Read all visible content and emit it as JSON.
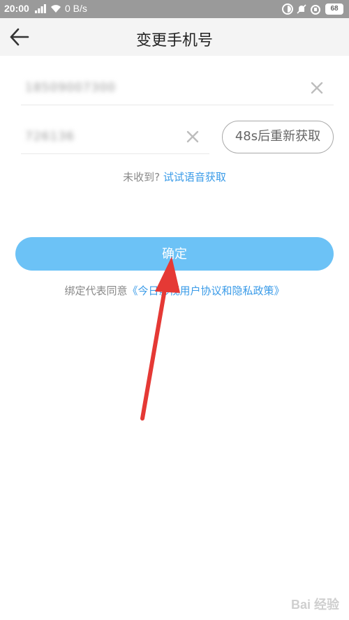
{
  "status_bar": {
    "time": "20:00",
    "network_speed": "0 B/s",
    "battery": "68"
  },
  "header": {
    "title": "变更手机号"
  },
  "form": {
    "phone_value": "18509007300",
    "code_value": "726136",
    "resend_label": "48s后重新获取"
  },
  "hint": {
    "prefix": "未收到?",
    "voice_link": "试试语音获取"
  },
  "confirm_label": "确定",
  "agreement": {
    "prefix": "绑定代表同意",
    "link": "《今日影视用户协议和隐私政策》"
  },
  "watermark": "Bai 经验",
  "colors": {
    "accent": "#6cc2f6",
    "link": "#3a9be8",
    "arrow": "#e53935"
  }
}
